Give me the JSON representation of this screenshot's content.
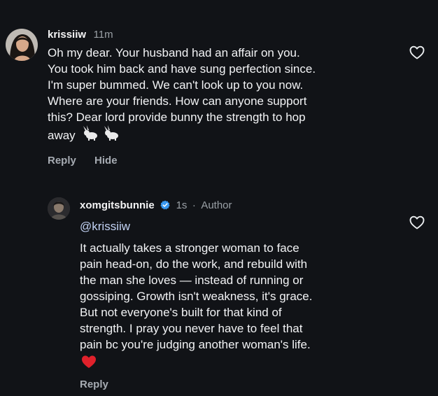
{
  "comment1": {
    "username": "krissiiw",
    "time": "11m",
    "text_lines": [
      "Oh my dear. Your husband had an affair on you.",
      "You took him back and have sung perfection since.",
      "I'm super bummed. We can't look up to you now.",
      "Where are your friends. How can anyone support",
      "this? Dear lord provide bunny the strength to hop",
      "away"
    ],
    "emoji": "🐇🐇",
    "reply_label": "Reply",
    "hide_label": "Hide"
  },
  "comment2": {
    "username": "xomgitsbunnie",
    "time": "1s",
    "separator": "·",
    "author_label": "Author",
    "mention": "@krissiiw",
    "text_lines": [
      "It actually takes a stronger woman to face",
      "pain head-on, do the work, and rebuild with",
      "the man she loves — instead of running or",
      "gossiping. Growth isn't weakness, it's grace.",
      "But not everyone's built for that kind of",
      "strength. I pray you never have to feel that",
      "pain bc you're judging another woman's life."
    ],
    "emoji": "❤️",
    "reply_label": "Reply"
  },
  "colors": {
    "background": "#111317",
    "text": "#f2f3f5",
    "muted": "#9aa0a6",
    "verified": "#3897f0",
    "heart_emoji": "#e0212b"
  },
  "icons": {
    "like_1": "heart-outline-icon",
    "like_2": "heart-outline-icon",
    "verified": "verified-badge-icon"
  }
}
